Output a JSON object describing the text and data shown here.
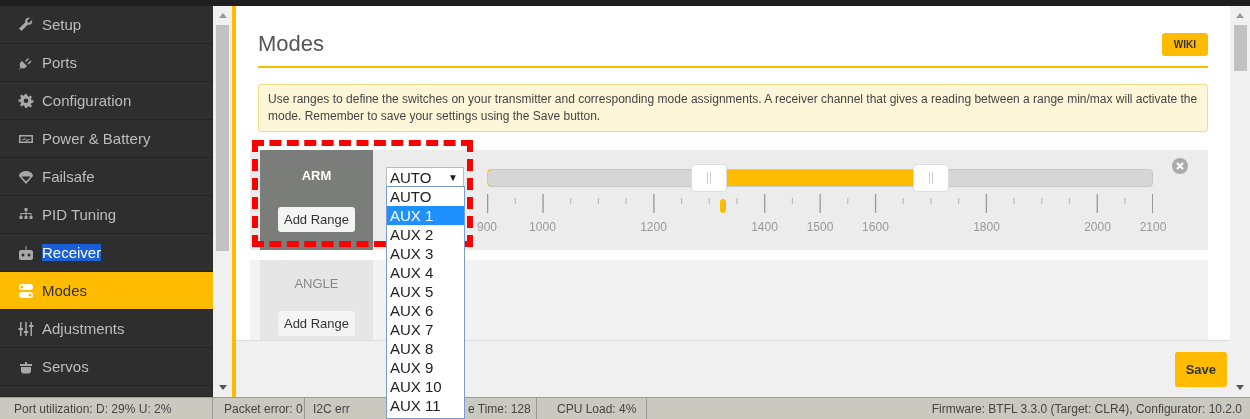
{
  "sidebar": {
    "items": [
      {
        "label": "Setup",
        "selected": false,
        "text_selected": false
      },
      {
        "label": "Ports",
        "selected": false,
        "text_selected": false
      },
      {
        "label": "Configuration",
        "selected": false,
        "text_selected": false
      },
      {
        "label": "Power & Battery",
        "selected": false,
        "text_selected": false
      },
      {
        "label": "Failsafe",
        "selected": false,
        "text_selected": false
      },
      {
        "label": "PID Tuning",
        "selected": false,
        "text_selected": false
      },
      {
        "label": "Receiver",
        "selected": false,
        "text_selected": true
      },
      {
        "label": "Modes",
        "selected": true,
        "text_selected": false
      },
      {
        "label": "Adjustments",
        "selected": false,
        "text_selected": false
      },
      {
        "label": "Servos",
        "selected": false,
        "text_selected": false
      }
    ]
  },
  "page": {
    "title": "Modes",
    "wiki_button": "WIKI",
    "note": "Use ranges to define the switches on your transmitter and corresponding mode assignments. A receiver channel that gives a reading between a range min/max will activate the mode. Remember to save your settings using the Save button.",
    "modes": [
      {
        "name": "ARM",
        "active": true,
        "add_range": "Add Range",
        "channel": {
          "value": "AUTO",
          "arrow": "▼",
          "open": true,
          "options": [
            {
              "label": "AUTO",
              "highlighted": false
            },
            {
              "label": "AUX 1",
              "highlighted": true
            },
            {
              "label": "AUX 2",
              "highlighted": false
            },
            {
              "label": "AUX 3",
              "highlighted": false
            },
            {
              "label": "AUX 4",
              "highlighted": false
            },
            {
              "label": "AUX 5",
              "highlighted": false
            },
            {
              "label": "AUX 6",
              "highlighted": false
            },
            {
              "label": "AUX 7",
              "highlighted": false
            },
            {
              "label": "AUX 8",
              "highlighted": false
            },
            {
              "label": "AUX 9",
              "highlighted": false
            },
            {
              "label": "AUX 10",
              "highlighted": false
            },
            {
              "label": "AUX 11",
              "highlighted": false
            }
          ]
        },
        "range": {
          "start": {
            "level": 0.333
          },
          "end": {
            "level": 0.667
          },
          "channel_marker": {
            "level": 0.354
          },
          "scale": [
            {
              "label": "900",
              "level": 0
            },
            {
              "label": "1000",
              "level": 0.0833
            },
            {
              "label": "1200",
              "level": 0.25
            },
            {
              "label": "1400",
              "level": 0.4167
            },
            {
              "label": "1500",
              "level": 0.5
            },
            {
              "label": "1600",
              "level": 0.5833
            },
            {
              "label": "1800",
              "level": 0.75
            },
            {
              "label": "2000",
              "level": 0.9167
            },
            {
              "label": "2100",
              "level": 1
            }
          ]
        }
      },
      {
        "name": "ANGLE",
        "active": false,
        "add_range": "Add Range"
      }
    ],
    "save_button": "Save"
  },
  "annotation": {
    "kind": "dashed_frame"
  },
  "status_bar": {
    "segments": [
      "Port utilization: D: 29% U: 2%",
      "Packet error: 0",
      "I2C err",
      "e Time: 128",
      "CPU Load: 4%"
    ],
    "firmware": "Firmware: BTFL 3.3.0 (Target: CLR4), Configurator: 10.2.0"
  }
}
